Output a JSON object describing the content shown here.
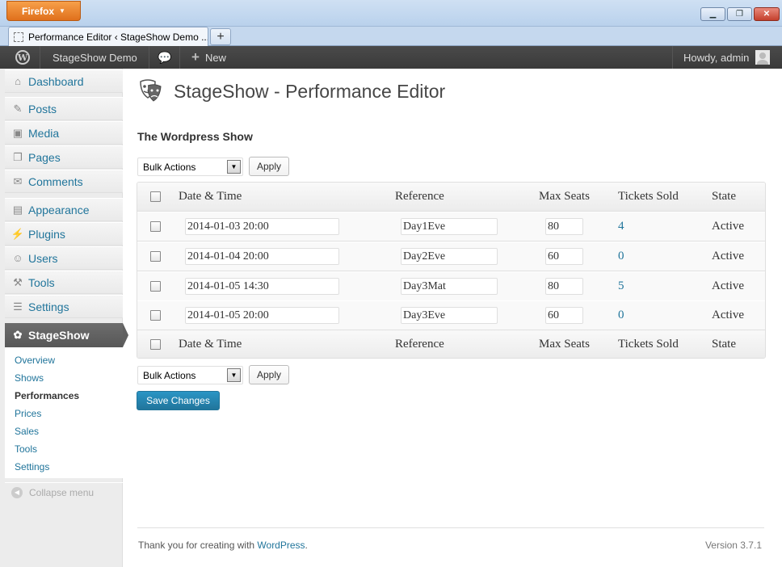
{
  "browser": {
    "menu_button": "Firefox",
    "tab_title": "Performance Editor ‹ StageShow Demo ...",
    "newtab_label": "+",
    "win_controls": {
      "minimize": "▁",
      "restore": "❐",
      "close": "✕"
    }
  },
  "adminbar": {
    "site_name": "StageShow Demo",
    "new_label": "New",
    "new_icon": "+",
    "comments_icon": "💬",
    "greeting": "Howdy, admin",
    "logo_glyph": "W"
  },
  "sidebar": {
    "items": [
      {
        "label": "Dashboard",
        "icon": "dashboard-icon",
        "glyph": "⌂"
      },
      {
        "label": "Posts",
        "icon": "pin-icon",
        "glyph": "✎"
      },
      {
        "label": "Media",
        "icon": "media-icon",
        "glyph": "▣"
      },
      {
        "label": "Pages",
        "icon": "pages-icon",
        "glyph": "❐"
      },
      {
        "label": "Comments",
        "icon": "comments-icon",
        "glyph": "✉"
      },
      {
        "label": "Appearance",
        "icon": "appearance-icon",
        "glyph": "▤"
      },
      {
        "label": "Plugins",
        "icon": "plugins-icon",
        "glyph": "⚡"
      },
      {
        "label": "Users",
        "icon": "users-icon",
        "glyph": "☺"
      },
      {
        "label": "Tools",
        "icon": "tools-icon",
        "glyph": "⚒"
      },
      {
        "label": "Settings",
        "icon": "settings-icon",
        "glyph": "☰"
      }
    ],
    "active": {
      "label": "StageShow",
      "icon": "stageshow-icon",
      "glyph": "✿"
    },
    "submenu": [
      "Overview",
      "Shows",
      "Performances",
      "Prices",
      "Sales",
      "Tools",
      "Settings"
    ],
    "submenu_current": "Performances",
    "collapse_label": "Collapse menu",
    "collapse_glyph": "◀"
  },
  "page": {
    "title": "StageShow - Performance Editor",
    "show_name": "The Wordpress Show"
  },
  "bulk": {
    "select_label": "Bulk Actions",
    "arrow_glyph": "▼",
    "apply_label": "Apply",
    "save_label": "Save Changes"
  },
  "table": {
    "columns": [
      "Date & Time",
      "Reference",
      "Max Seats",
      "Tickets Sold",
      "State"
    ],
    "rows": [
      {
        "datetime": "2014-01-03 20:00",
        "reference": "Day1Eve",
        "max_seats": "80",
        "tickets_sold": "4",
        "state": "Active"
      },
      {
        "datetime": "2014-01-04 20:00",
        "reference": "Day2Eve",
        "max_seats": "60",
        "tickets_sold": "0",
        "state": "Active"
      },
      {
        "datetime": "2014-01-05 14:30",
        "reference": "Day3Mat",
        "max_seats": "80",
        "tickets_sold": "5",
        "state": "Active"
      },
      {
        "datetime": "2014-01-05 20:00",
        "reference": "Day3Eve",
        "max_seats": "60",
        "tickets_sold": "0",
        "state": "Active"
      }
    ]
  },
  "footer": {
    "thanks_prefix": "Thank you for creating with ",
    "thanks_link": "WordPress",
    "thanks_suffix": ".",
    "version": "Version 3.7.1"
  },
  "colors": {
    "link": "#21759b",
    "adminbar": "#464646",
    "firefox_orange": "#e66000"
  }
}
